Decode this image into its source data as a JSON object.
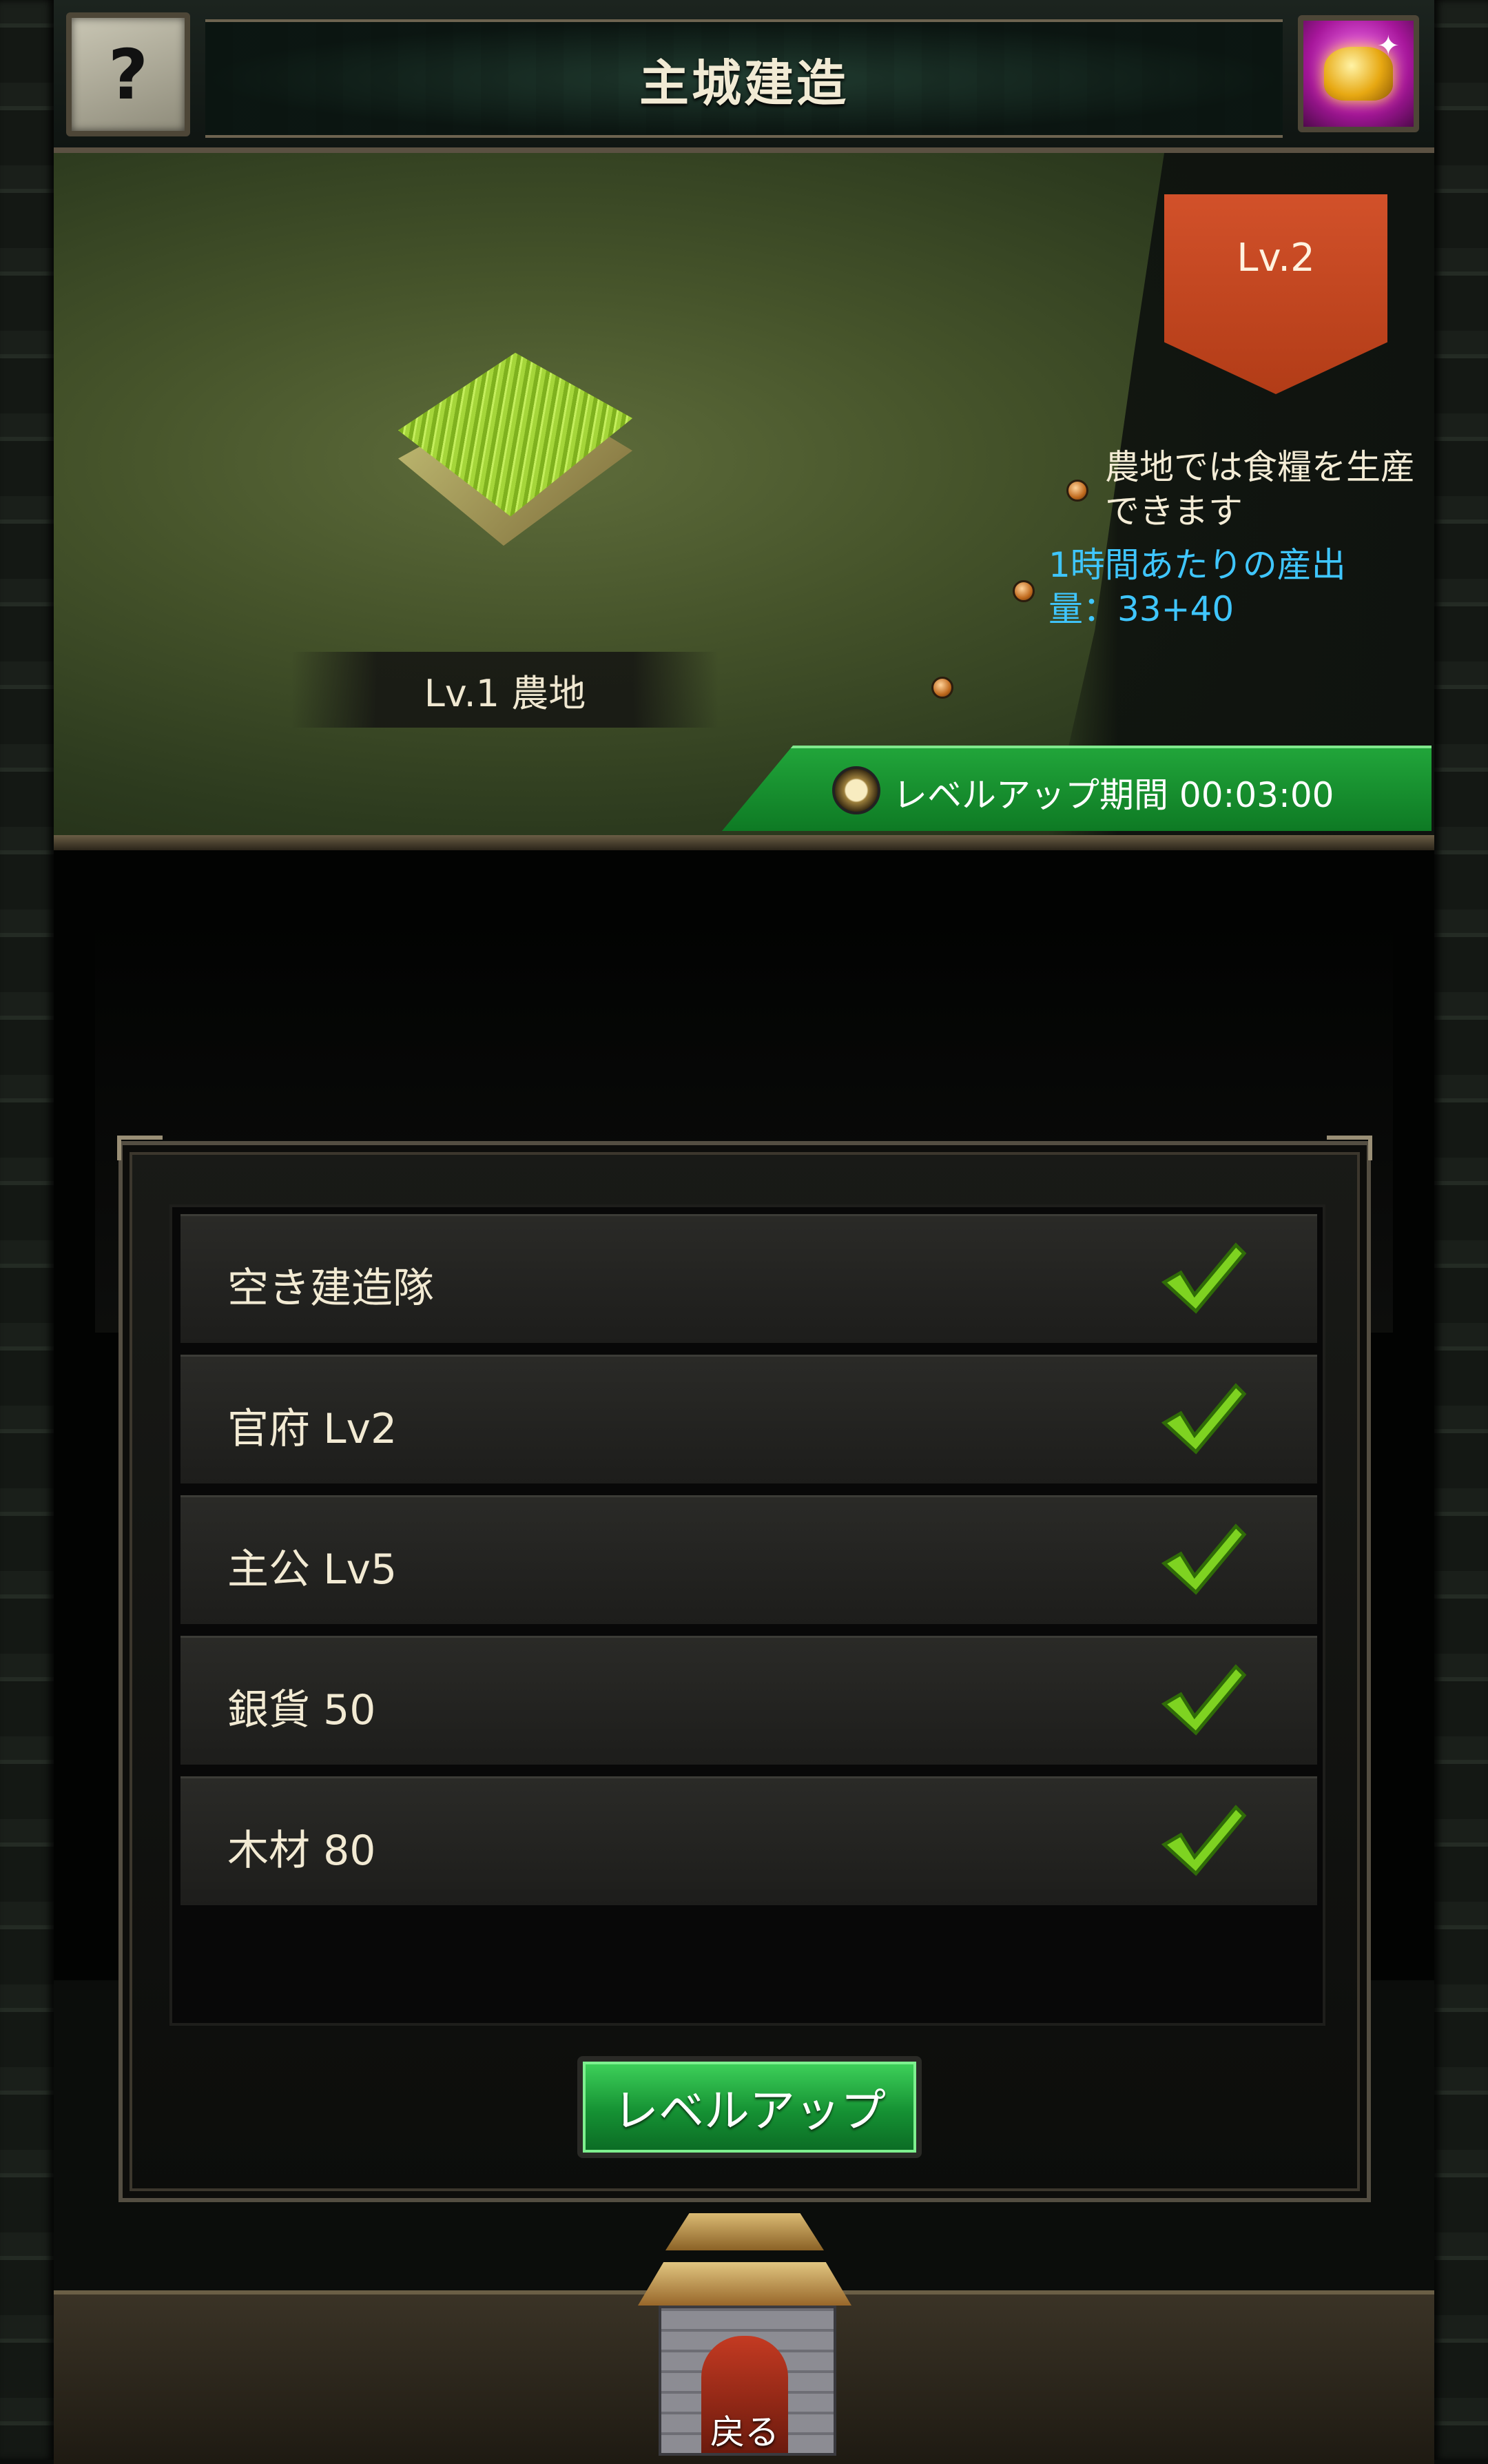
{
  "header": {
    "title": "主城建造",
    "help_label": "?"
  },
  "scene": {
    "building_label": "Lv.1 農地",
    "next_level": "Lv.2",
    "description": "農地では食糧を生産できます",
    "description_line1": "農地では食糧を生産",
    "description_line2": "できます",
    "output_line1": "1時間あたりの産出",
    "output_line2": "量：33+40",
    "upgrade_time": "レベルアップ期間 00:03:00"
  },
  "requirements": [
    {
      "label": "空き建造隊",
      "met": true
    },
    {
      "label": "官府 Lv2",
      "met": true
    },
    {
      "label": "主公 Lv5",
      "met": true
    },
    {
      "label": "銀貨 50",
      "met": true
    },
    {
      "label": "木材 80",
      "met": true
    }
  ],
  "actions": {
    "level_up": "レベルアップ",
    "back": "戻る"
  },
  "colors": {
    "accent_green": "#159133",
    "banner_orange": "#c8461f",
    "cyan_text": "#3fc6ff",
    "check_green": "#7ed321"
  },
  "icons": [
    "help-icon",
    "reward-chest-icon",
    "clock-icon",
    "checkmark-icon",
    "city-gate-icon"
  ]
}
